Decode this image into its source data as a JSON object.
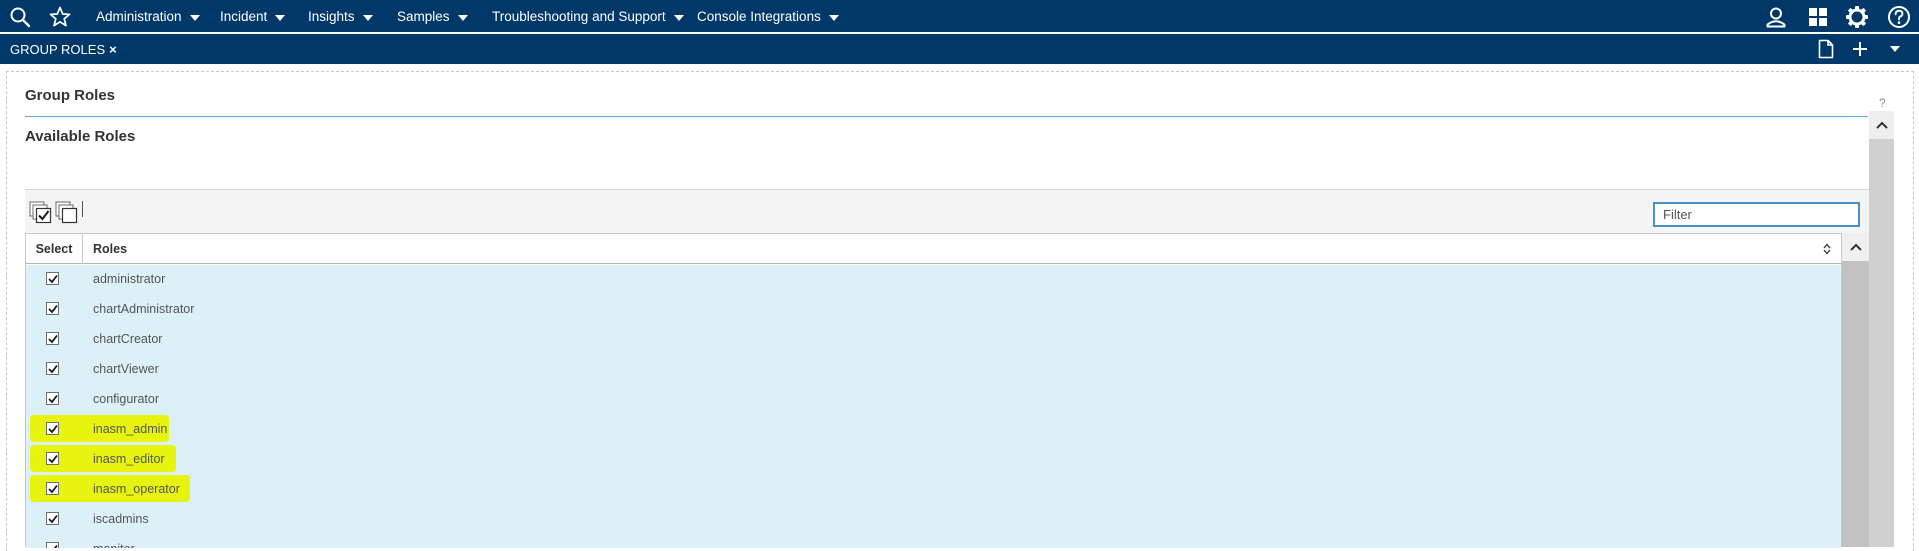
{
  "nav": {
    "menus": [
      {
        "label": "Administration"
      },
      {
        "label": "Incident"
      },
      {
        "label": "Insights"
      },
      {
        "label": "Samples"
      },
      {
        "label": "Troubleshooting and Support"
      },
      {
        "label": "Console Integrations"
      }
    ],
    "icons": [
      "search-icon",
      "star-icon",
      "user-icon",
      "apps-grid-icon",
      "gear-icon",
      "help-icon"
    ]
  },
  "tabbar": {
    "tab_label": "GROUP ROLES",
    "close_glyph": "×",
    "icons": [
      "new-page-icon",
      "add-icon",
      "chevron-down-icon"
    ]
  },
  "panel": {
    "title": "Group Roles",
    "help_glyph": "?",
    "section_title": "Available Roles"
  },
  "toolbar": {
    "icons": [
      "select-all-icon",
      "deselect-all-icon"
    ],
    "filter_placeholder": "Filter"
  },
  "table": {
    "columns": [
      "Select",
      "Roles"
    ],
    "rows": [
      {
        "role": "administrator",
        "checked": true,
        "highlighted": false
      },
      {
        "role": "chartAdministrator",
        "checked": true,
        "highlighted": false
      },
      {
        "role": "chartCreator",
        "checked": true,
        "highlighted": false
      },
      {
        "role": "chartViewer",
        "checked": true,
        "highlighted": false
      },
      {
        "role": "configurator",
        "checked": true,
        "highlighted": false
      },
      {
        "role": "inasm_admin",
        "checked": true,
        "highlighted": true
      },
      {
        "role": "inasm_editor",
        "checked": true,
        "highlighted": true
      },
      {
        "role": "inasm_operator",
        "checked": true,
        "highlighted": true
      },
      {
        "role": "iscadmins",
        "checked": true,
        "highlighted": false
      },
      {
        "role": "monitor",
        "checked": true,
        "highlighted": false
      }
    ]
  },
  "colors": {
    "nav_bg": "#01386a",
    "row_bg": "#dcf0f8",
    "highlight": "#e6f40f",
    "title_rule": "#5aa9d6"
  }
}
